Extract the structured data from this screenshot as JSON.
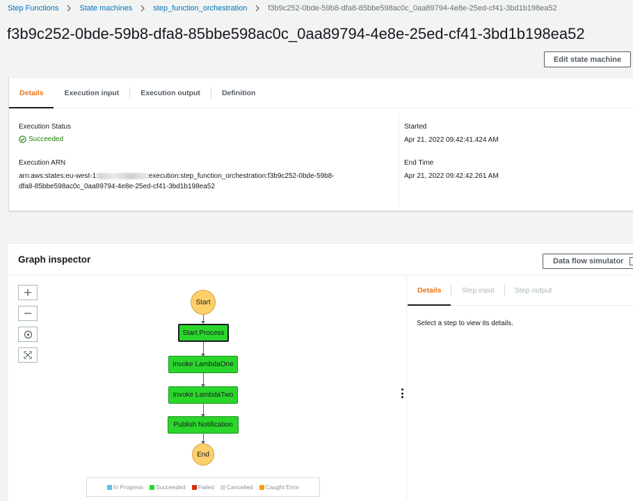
{
  "breadcrumb": {
    "items": [
      "Step Functions",
      "State machines",
      "step_function_orchestration"
    ],
    "current": "f3b9c252-0bde-59b8-dfa8-85bbe598ac0c_0aa89794-4e8e-25ed-cf41-3bd1b198ea52"
  },
  "page_title": "f3b9c252-0bde-59b8-dfa8-85bbe598ac0c_0aa89794-4e8e-25ed-cf41-3bd1b198ea52",
  "edit_button": "Edit state machine",
  "tabs": [
    "Details",
    "Execution input",
    "Execution output",
    "Definition"
  ],
  "details": {
    "status_label": "Execution Status",
    "status_value": "Succeeded",
    "arn_label": "Execution ARN",
    "arn_prefix": "arn:aws:states:eu-west-1:",
    "arn_suffix_line1": ":execution:step_function_orchestration:f3b9c252-0bde-59b8-",
    "arn_line2": "dfa8-85bbe598ac0c_0aa89794-4e8e-25ed-cf41-3bd1b198ea52",
    "started_label": "Started",
    "started_value": "Apr 21, 2022 09:42:41.424 AM",
    "end_label": "End Time",
    "end_value": "Apr 21, 2022 09:42:42.261 AM"
  },
  "graph": {
    "title": "Graph inspector",
    "simulator_button": "Data flow simulator",
    "nodes": {
      "start": "Start",
      "start_process": "Start Process",
      "lambda_one": "Invoke LambdaOne",
      "lambda_two": "Invoke LambdaTwo",
      "publish": "Publish Notification",
      "end": "End"
    },
    "legend": [
      {
        "label": "In Progress",
        "color": "#5bc0de"
      },
      {
        "label": "Succeeded",
        "color": "#2bd62b"
      },
      {
        "label": "Failed",
        "color": "#d13212"
      },
      {
        "label": "Cancelled",
        "color": "#d5dbdb"
      },
      {
        "label": "Caught Error",
        "color": "#f89c1c"
      }
    ]
  },
  "side_panel": {
    "tabs": [
      "Details",
      "Step input",
      "Step output"
    ],
    "message": "Select a step to view its details."
  }
}
